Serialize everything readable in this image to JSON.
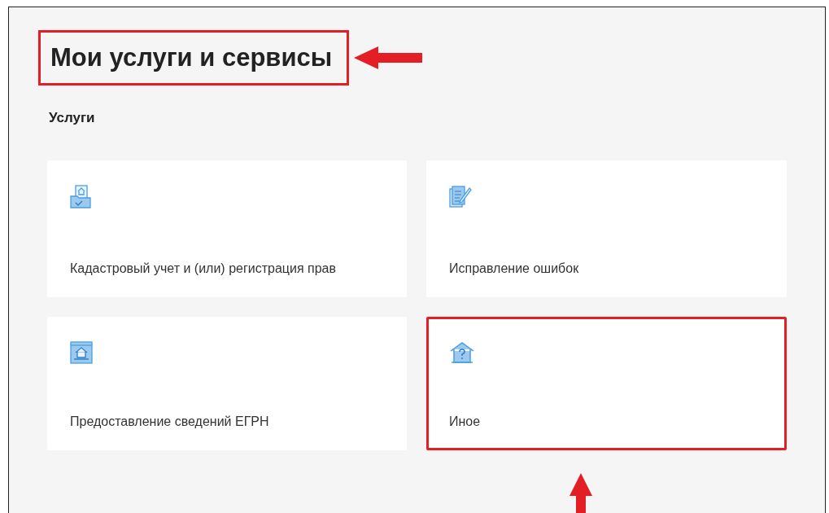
{
  "heading": {
    "text": "Мои услуги и сервисы",
    "highlighted": true
  },
  "section_title": "Услуги",
  "cards": [
    {
      "label": "Кадастровый учет и (или) регистрация прав",
      "highlighted": false
    },
    {
      "label": "Исправление ошибок",
      "highlighted": false
    },
    {
      "label": "Предоставление сведений ЕГРН",
      "highlighted": false
    },
    {
      "label": "Иное",
      "highlighted": true
    }
  ]
}
